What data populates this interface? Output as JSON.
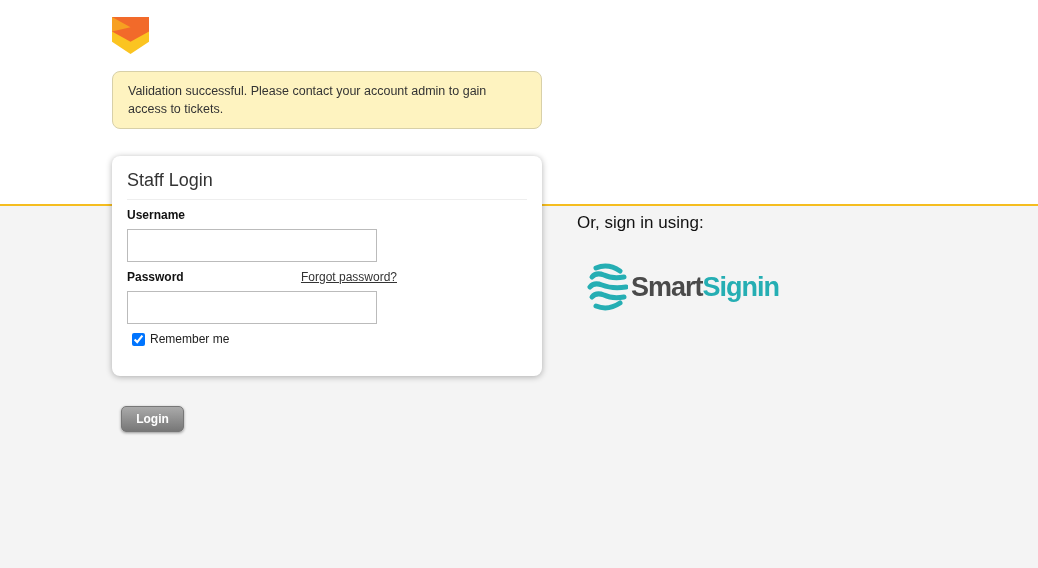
{
  "alert": {
    "message": "Validation successful. Please contact your account admin to gain access to tickets."
  },
  "login_card": {
    "title": "Staff Login",
    "username": {
      "label": "Username"
    },
    "password": {
      "label": "Password",
      "forgot_link": "Forgot password?"
    },
    "remember_me": {
      "label": "Remember me",
      "checked": true
    }
  },
  "login_button": "Login",
  "alternative": {
    "heading": "Or, sign in using:",
    "provider": {
      "name_part_1": "Smart",
      "name_part_2": "Signin"
    }
  }
}
